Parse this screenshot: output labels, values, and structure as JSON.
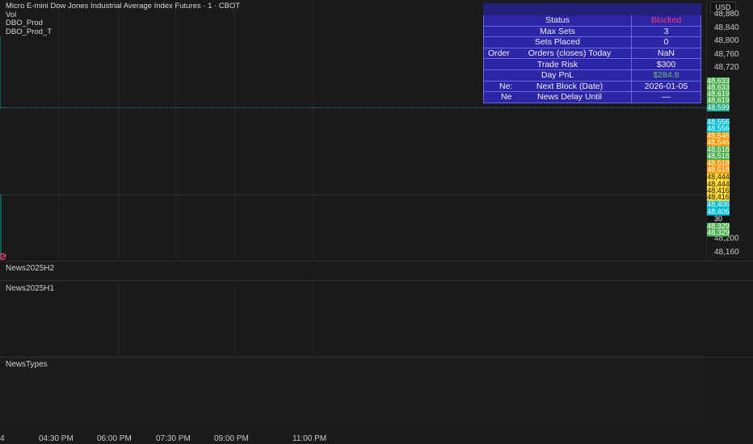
{
  "chart": {
    "title": "Micro E-mini Dow Jones Industrial Average Index Futures · 1 · CBOT",
    "indicators": [
      "Vol",
      "DBO_Prod",
      "DBO_Prod_T"
    ]
  },
  "axis": {
    "currency_button": "USD",
    "ticks": [
      "48,880",
      "48,840",
      "48,800",
      "48,760",
      "48,720",
      "48,200",
      "48,160"
    ],
    "price_labels": [
      {
        "text": "48,633",
        "color": "#4caf50"
      },
      {
        "text": "48,633",
        "color": "#4caf50"
      },
      {
        "text": "48,619",
        "color": "#4caf50"
      },
      {
        "text": "48,619",
        "color": "#4caf50"
      },
      {
        "text": "48,599",
        "color": "#22ab94"
      },
      {
        "text": "48,556",
        "color": "#00bcd4"
      },
      {
        "text": "48,556",
        "color": "#00bcd4"
      },
      {
        "text": "48,546",
        "color": "#ff9800"
      },
      {
        "text": "48,546",
        "color": "#ff9800"
      },
      {
        "text": "48,518",
        "color": "#4caf50"
      },
      {
        "text": "48,518",
        "color": "#4caf50"
      },
      {
        "text": "48,518",
        "color": "#ff9800"
      },
      {
        "text": "48,518",
        "color": "#ff9800"
      },
      {
        "text": "48,444",
        "color": "#fdd835"
      },
      {
        "text": "48,444",
        "color": "#fdd835"
      },
      {
        "text": "48,416",
        "color": "#fdd835"
      },
      {
        "text": "48,416",
        "color": "#fdd835"
      },
      {
        "text": "48,406",
        "color": "#00bcd4"
      },
      {
        "text": "48,406",
        "color": "#00bcd4"
      },
      {
        "text": "30",
        "color": "#009688"
      },
      {
        "text": "48,329",
        "color": "#4caf50"
      },
      {
        "text": "48,329",
        "color": "#4caf50"
      }
    ]
  },
  "info_table": {
    "rows": [
      {
        "label": "Status",
        "value": "Blocked",
        "value_color": "#ff3b6b"
      },
      {
        "label": "Max Sets",
        "value": "3"
      },
      {
        "label": "Sets Placed",
        "value": "0"
      },
      {
        "label_prefix": "Order",
        "label": "Orders (closes) Today",
        "value": "NaN"
      },
      {
        "label": "Trade Risk",
        "value": "$300"
      },
      {
        "label": "Day PnL",
        "value": "$284.8",
        "value_color": "#66bb6a"
      },
      {
        "label_prefix": "Ne:",
        "label": "Next Block (Date)",
        "value": "2026-01-05"
      },
      {
        "label_prefix": "Ne",
        "label": "News Delay Until",
        "value": "—"
      }
    ]
  },
  "panes": {
    "pane1": "News2025H2",
    "pane2": "News2025H1",
    "pane3": "NewsTypes"
  },
  "time_axis": {
    "edge_label": "4",
    "labels": [
      "04:30 PM",
      "06:00 PM",
      "07:30 PM",
      "09:00 PM",
      "11:00 PM"
    ]
  }
}
